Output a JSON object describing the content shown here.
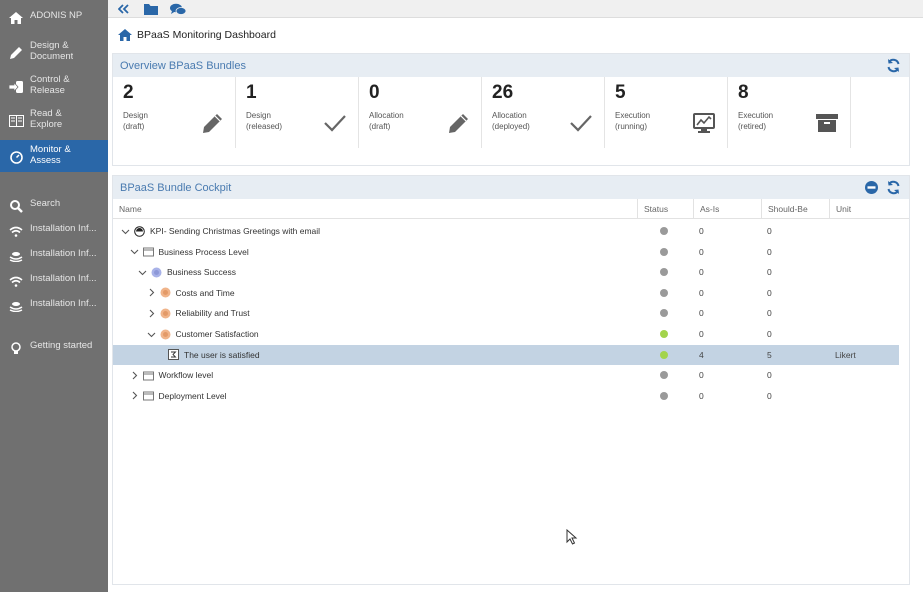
{
  "app": {
    "name": "ADONIS NP"
  },
  "sidebar": {
    "items": [
      {
        "label": "ADONIS NP",
        "icon": "home-icon",
        "active": false
      },
      {
        "label": "Design &\nDocument",
        "icon": "pencil-icon",
        "active": false
      },
      {
        "label": "Control &\nRelease",
        "icon": "sign-in-icon",
        "active": false
      },
      {
        "label": "Read &\nExplore",
        "icon": "book-icon",
        "active": false
      },
      {
        "label": "Monitor &\nAssess",
        "icon": "dashboard-icon",
        "active": true
      },
      {
        "label": "Search",
        "icon": "search-icon",
        "active": false
      },
      {
        "label": "Installation Inf...",
        "icon": "wifi-icon",
        "active": false
      },
      {
        "label": "Installation Inf...",
        "icon": "stack-icon",
        "active": false
      },
      {
        "label": "Installation Inf...",
        "icon": "wifi-icon",
        "active": false
      },
      {
        "label": "Installation Inf...",
        "icon": "stack-icon",
        "active": false
      },
      {
        "label": "Getting started",
        "icon": "lightbulb-icon",
        "active": false
      }
    ]
  },
  "topbar": {
    "icons": [
      "collapse-icon",
      "folder-icon",
      "comments-icon"
    ]
  },
  "page": {
    "title": "BPaaS Monitoring Dashboard"
  },
  "overview": {
    "title": "Overview BPaaS Bundles",
    "cards": [
      {
        "count": "2",
        "line1": "Design",
        "line2": "(draft)",
        "icon": "pencil-icon"
      },
      {
        "count": "1",
        "line1": "Design",
        "line2": "(released)",
        "icon": "check-icon"
      },
      {
        "count": "0",
        "line1": "Allocation",
        "line2": "(draft)",
        "icon": "pencil-icon"
      },
      {
        "count": "26",
        "line1": "Allocation",
        "line2": "(deployed)",
        "icon": "check-icon"
      },
      {
        "count": "5",
        "line1": "Execution",
        "line2": "(running)",
        "icon": "monitor-chart-icon"
      },
      {
        "count": "8",
        "line1": "Execution",
        "line2": "(retired)",
        "icon": "archive-icon"
      }
    ]
  },
  "cockpit": {
    "title": "BPaaS Bundle Cockpit",
    "columns": [
      "Name",
      "Status",
      "As-Is",
      "Should-Be",
      "Unit"
    ],
    "rows": [
      {
        "name": "KPI- Sending Christmas Greetings with email",
        "level": 0,
        "expanded": true,
        "icon": "kpi-icon",
        "status": "gray",
        "as_is": "0",
        "should_be": "0",
        "unit": "",
        "selected": false
      },
      {
        "name": "Business Process Level",
        "level": 1,
        "expanded": true,
        "icon": "folder-outline-icon",
        "status": "gray",
        "as_is": "0",
        "should_be": "0",
        "unit": "",
        "selected": false
      },
      {
        "name": "Business Success",
        "level": 2,
        "expanded": true,
        "icon": "goal-blue-icon",
        "status": "gray",
        "as_is": "0",
        "should_be": "0",
        "unit": "",
        "selected": false
      },
      {
        "name": "Costs and Time",
        "level": 3,
        "expanded": false,
        "icon": "goal-orange-icon",
        "status": "gray",
        "as_is": "0",
        "should_be": "0",
        "unit": "",
        "selected": false
      },
      {
        "name": "Reliability and Trust",
        "level": 3,
        "expanded": false,
        "icon": "goal-orange-icon",
        "status": "gray",
        "as_is": "0",
        "should_be": "0",
        "unit": "",
        "selected": false
      },
      {
        "name": "Customer Satisfaction",
        "level": 3,
        "expanded": true,
        "icon": "goal-orange-icon",
        "status": "green",
        "as_is": "0",
        "should_be": "0",
        "unit": "",
        "selected": false
      },
      {
        "name": "The user is satisfied",
        "level": 4,
        "expanded": null,
        "icon": "indicator-icon",
        "status": "green",
        "as_is": "4",
        "should_be": "5",
        "unit": "Likert",
        "selected": true
      },
      {
        "name": "Workflow level",
        "level": 1,
        "expanded": false,
        "icon": "folder-outline-icon",
        "status": "gray",
        "as_is": "0",
        "should_be": "0",
        "unit": "",
        "selected": false
      },
      {
        "name": "Deployment Level",
        "level": 1,
        "expanded": false,
        "icon": "folder-outline-icon",
        "status": "gray",
        "as_is": "0",
        "should_be": "0",
        "unit": "",
        "selected": false
      }
    ]
  },
  "colors": {
    "accent": "#2a67a8",
    "sidebar": "#707070",
    "panel_header": "#e7edf3",
    "status_gray": "#9a9a9a",
    "status_green": "#a3d44c",
    "selected_row": "#c3d3e3"
  }
}
